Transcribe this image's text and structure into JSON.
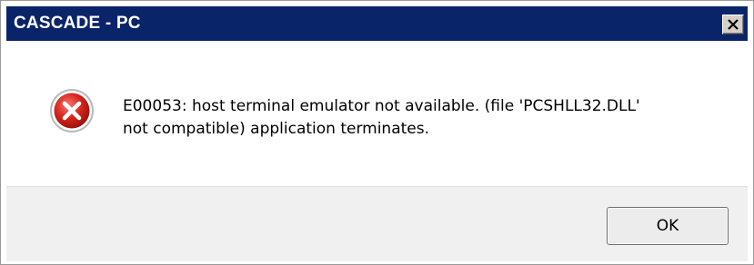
{
  "window": {
    "title": "CASCADE - PC",
    "close_icon": "close-icon"
  },
  "message": {
    "icon": "error-icon",
    "line1": "E00053: host terminal emulator not available. (file 'PCSHLL32.DLL'",
    "line2": "not compatible) application terminates."
  },
  "buttons": {
    "ok_label": "OK"
  },
  "colors": {
    "titlebar": "#0a246a",
    "error_red": "#d7261f",
    "footer_bg": "#f0f0f0"
  }
}
